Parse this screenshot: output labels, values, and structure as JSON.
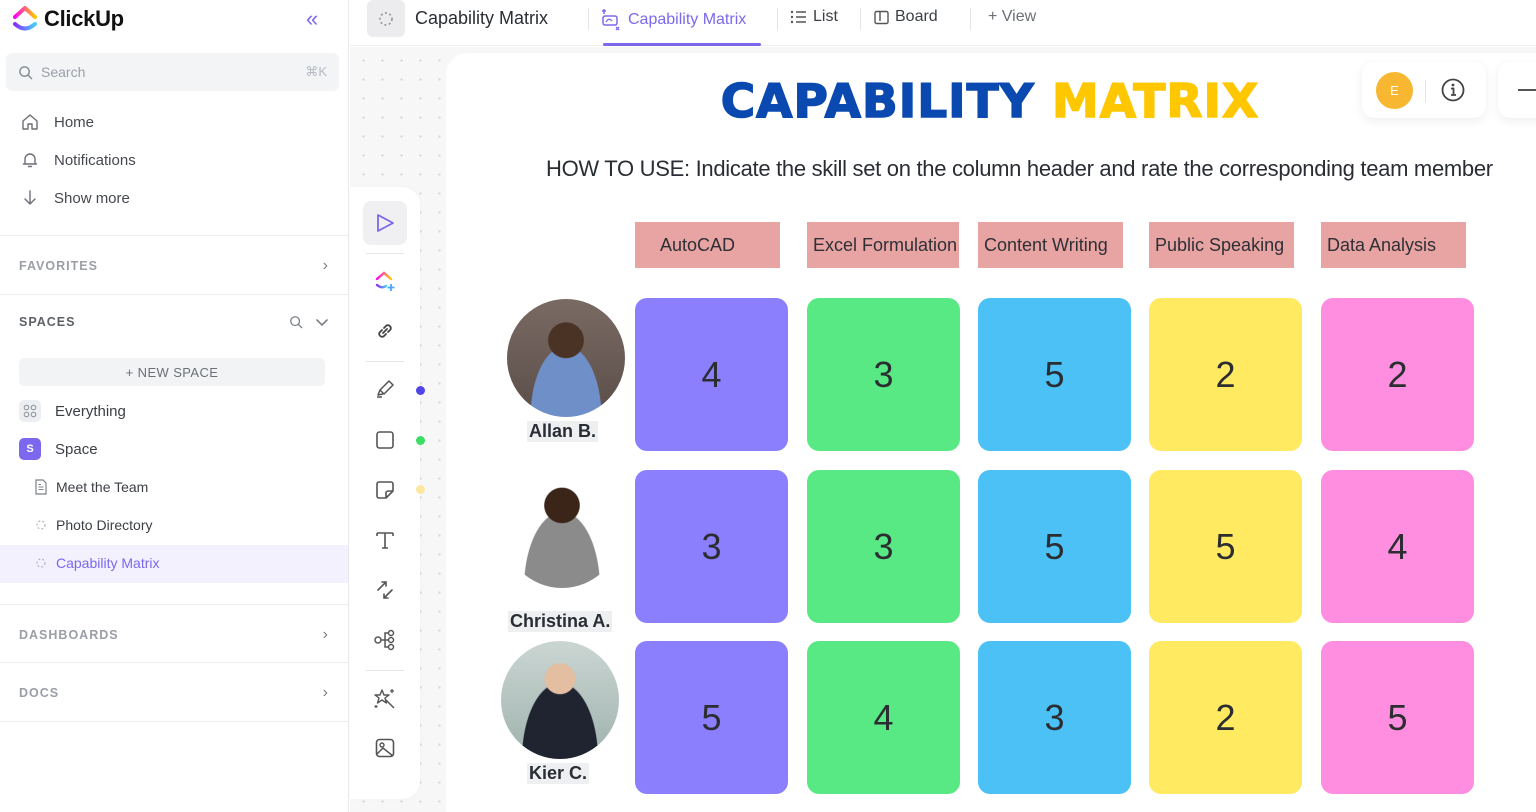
{
  "app": {
    "name": "ClickUp"
  },
  "sidebar": {
    "search": {
      "placeholder": "Search",
      "shortcut": "⌘K"
    },
    "nav": [
      {
        "label": "Home",
        "icon": "home-icon"
      },
      {
        "label": "Notifications",
        "icon": "bell-icon"
      },
      {
        "label": "Show more",
        "icon": "arrow-down-icon"
      }
    ],
    "sections": {
      "favorites": "FAVORITES",
      "spaces": "SPACES",
      "dashboards": "DASHBOARDS",
      "docs": "DOCS"
    },
    "new_space": "+ NEW SPACE",
    "everything": "Everything",
    "space": {
      "label": "Space",
      "badge": "S",
      "color": "#7b68ee"
    },
    "children": [
      {
        "label": "Meet the Team",
        "icon": "doc-icon"
      },
      {
        "label": "Photo Directory",
        "icon": "whiteboard-icon"
      },
      {
        "label": "Capability Matrix",
        "icon": "whiteboard-icon",
        "active": true
      }
    ]
  },
  "topbar": {
    "location_title": "Capability Matrix",
    "tabs": [
      {
        "label": "Capability Matrix",
        "active": true
      },
      {
        "label": "List"
      },
      {
        "label": "Board"
      },
      {
        "label": "+ View"
      }
    ]
  },
  "board": {
    "title_part1": "CAPABILITY",
    "title_part2": "MATRIX",
    "instructions": "HOW TO USE: Indicate the skill set on the column header and rate the corresponding team member",
    "user_avatar": "E",
    "skills": [
      "AutoCAD",
      "Excel Formulation",
      "Content Writing",
      "Public Speaking",
      "Data Analysis"
    ],
    "skill_colors": [
      "#8b7ffe",
      "#58e884",
      "#4bc1f5",
      "#ffea62",
      "#ff8ee0"
    ],
    "members": [
      {
        "name": "Allan B.",
        "ratings": [
          4,
          3,
          5,
          2,
          2
        ]
      },
      {
        "name": "Christina A.",
        "ratings": [
          3,
          3,
          5,
          5,
          4
        ]
      },
      {
        "name": "Kier C.",
        "ratings": [
          5,
          4,
          3,
          2,
          5
        ]
      }
    ]
  },
  "toolbar": {
    "tools": [
      "select",
      "clickup-ai",
      "link",
      "pen",
      "shape",
      "sticky-note",
      "text",
      "connector",
      "mind-map",
      "ai-magic",
      "image"
    ],
    "color_dots": [
      "#5046e5",
      "#3ddc65",
      "#fbe7a1"
    ]
  }
}
